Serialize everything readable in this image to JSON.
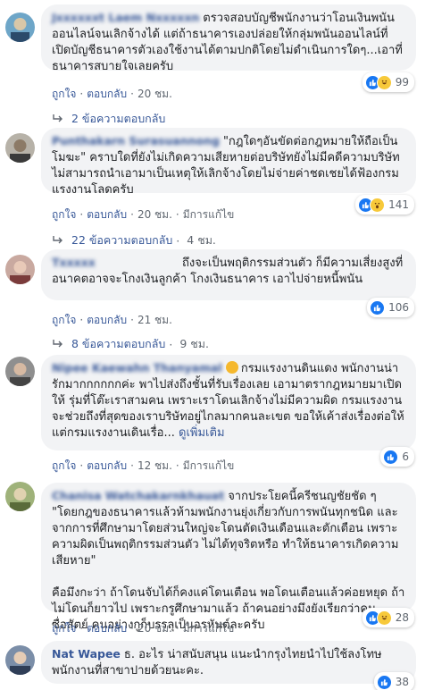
{
  "comments": [
    {
      "name": "Jxxxxxxt Laem Nxxxxxn",
      "text": "ตรวจสอบบัญชีพนักงานว่าโอนเงินพนันออนไลน์จนเลิกจ้างได้ แต่ถ้าธนาคารเองปล่อยให้กลุ่มพนันออนไลน์ที่เปิดบัญชีธนาคารตัวเองใช้งานได้ตามปกติโดยไม่ดำเนินการใดๆ...เอาที่ธนาคารสบายใจเลยครับ",
      "like": "ถูกใจ",
      "reply": "ตอบกลับ",
      "time": "20 ชม.",
      "reaction_count": "99",
      "reactions": [
        "like-icon",
        "haha-icon"
      ],
      "replies_label": "2 ข้อความตอบกลับ",
      "replies_time": ""
    },
    {
      "name": "Punthakarn Surasuannong",
      "text": "\"กฎใดๆอันขัดต่อกฎหมายให้ถือเป็นโมฆะ\" คราบใดที่ยังไม่เกิดความเสียหายต่อบริษัทยังไม่มีคดีความบริษัทไม่สามารถนำเอามาเป็นเหตุให้เลิกจ้างโดยไม่จ่ายค่าชดเชยได้ฟ้องกรมแรงงานโลดครับ",
      "like": "ถูกใจ",
      "reply": "ตอบกลับ",
      "time": "20 ชม.",
      "edited": "มีการแก้ไข",
      "reaction_count": "141",
      "reactions": [
        "like-icon",
        "wow-icon"
      ],
      "replies_label": "22 ข้อความตอบกลับ",
      "replies_time": "4 ชม."
    },
    {
      "name": "Txxxxx",
      "text": "ถึงจะเป็นพฤติกรรมส่วนตัว ก็มีความเสี่ยงสูงที่อนาคตอาจจะโกงเงินลูกค้า โกงเงินธนาคาร เอาไปจ่ายหนี้พนัน",
      "like": "ถูกใจ",
      "reply": "ตอบกลับ",
      "time": "21 ชม.",
      "reaction_count": "106",
      "reactions": [
        "like-icon"
      ],
      "replies_label": "8 ข้อความตอบกลับ",
      "replies_time": "9 ชม."
    },
    {
      "name": "Nipee Kaewahn Thanyamal",
      "text": "กรมแรงงานดินแดง พนักงานน่ารักมากกกกกกค่ะ พาไปส่งถึงชั้นที่รับเรื่องเลย เอามาตรากฎหมายมาเปิดให้ รุ่มที่โต๊ะเราสามคน เพราะเราโดนเลิกจ้างไม่มีความผิด กรมแรงงานจะช่วยถึงที่สุดของเราบริษัทอยู่ไกลมากคนละเขต ขอให้เค้าส่งเรื่องต่อให้แต่กรมแรงงานเดินเรื่อ...",
      "more": "ดูเพิ่มเติม",
      "like": "ถูกใจ",
      "reply": "ตอบกลับ",
      "time": "12 ชม.",
      "edited": "มีการแก้ไข",
      "reaction_count": "6",
      "reactions": [
        "like-icon"
      ],
      "replies_label": "",
      "replies_time": ""
    },
    {
      "name": "Chanisa Watchakarnkhauat",
      "text": "จากประโยคนี้ครีชนญชัยชัด ๆ \"โดยกฎของธนาคารแล้วห้ามพนักงานยุ่งเกี่ยวกับการพนันทุกชนิด และจากการที่ศึกษามาโดยส่วนใหญ่จะโดนตัดเงินเดือนและตักเตือน เพราะความผิดเป็นพฤติกรรมส่วนตัว ไม่ได้ทุจริตหรือ ทำให้ธนาคารเกิดความเสียหาย\"\n\nคือมึงกะว่า ถ้าโดนจับได้ก็คงแค่โดนเตือน พอโดนเตือนแล้วค่อยหยุด ถ้าไม่โดนก็ยาวไป เพราะกรูศึกษามาแล้ว ถ้าคนอย่างมึงยังเรียกว่าคนซื่อสัตย์ คนอย่างกูก็บรรลุเป็นอรหันต์ละครับ",
      "like": "ถูกใจ",
      "reply": "ตอบกลับ",
      "time": "20 ชม.",
      "edited": "มีการแก้ไข",
      "reaction_count": "28",
      "reactions": [
        "like-icon",
        "haha-icon"
      ],
      "replies_label": "",
      "replies_time": ""
    },
    {
      "name": "Nat Wapee",
      "text": "ธ. อะไร น่าสนับสนุน แนะนำกรุงไทยนำไปใช้ลงโทษพนักงานที่สาขาปายด้วยนะคะ.",
      "like": "ถูกใจ",
      "reply": "ตอบกลับ",
      "time": "",
      "reaction_count": "38",
      "reactions": [
        "like-icon"
      ],
      "replies_label": "",
      "replies_time": ""
    }
  ],
  "colors": {
    "link": "#385898",
    "bubble": "#f2f3f5",
    "muted": "#606770",
    "like": "#1877f2"
  }
}
